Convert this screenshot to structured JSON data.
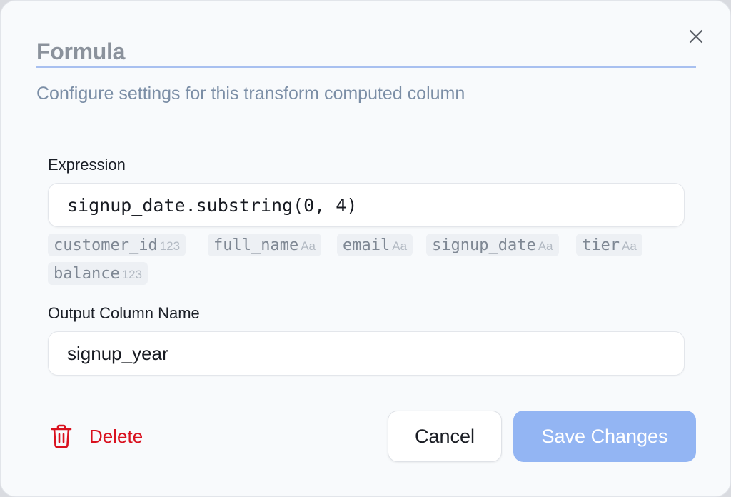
{
  "dialog": {
    "title": "Formula",
    "subtitle": "Configure settings for this transform computed column",
    "close_icon": "close-icon"
  },
  "expression": {
    "label": "Expression",
    "value": "signup_date.substring(0, 4)"
  },
  "columns": [
    {
      "name": "customer_id",
      "type": "123"
    },
    {
      "name": "full_name",
      "type": "Aa"
    },
    {
      "name": "email",
      "type": "Aa"
    },
    {
      "name": "signup_date",
      "type": "Aa"
    },
    {
      "name": "tier",
      "type": "Aa"
    },
    {
      "name": "balance",
      "type": "123"
    }
  ],
  "output": {
    "label": "Output Column Name",
    "value": "signup_year"
  },
  "actions": {
    "delete_label": "Delete",
    "delete_icon": "trash-icon",
    "cancel_label": "Cancel",
    "save_label": "Save Changes"
  },
  "colors": {
    "accent": "#93b5f3",
    "danger": "#d9111f",
    "title_underline": "#a8c0f0"
  }
}
